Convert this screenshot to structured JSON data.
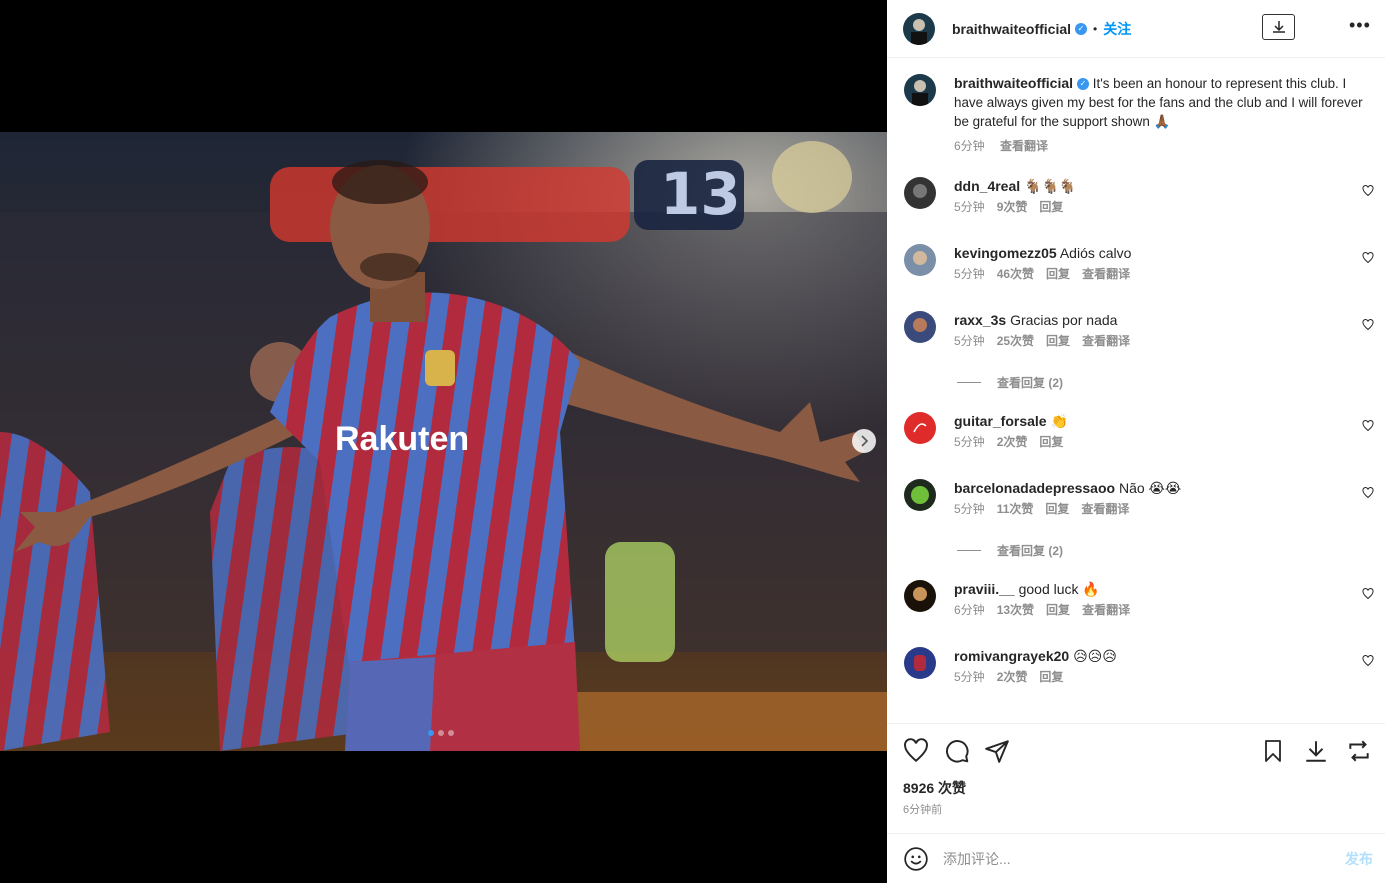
{
  "post": {
    "username": "braithwaiteofficial",
    "follow_label": "关注",
    "separator": "•",
    "more_label": "•••",
    "caption": "It's been an honour to represent this club. I have always given my best for the fans and the club and I will forever be grateful for the support shown 🙏🏾",
    "caption_time": "6分钟",
    "caption_translate": "查看翻译",
    "likes": "8926 次赞",
    "posted_ago": "6分钟前",
    "image_alt": "Footballer celebrating in red and blue striped Rakuten jersey",
    "carousel": {
      "count": 3,
      "active": 0
    }
  },
  "comments": [
    {
      "user": "ddn_4real",
      "text": "🐐🐐🐐",
      "time": "5分钟",
      "likes": "9次赞",
      "reply": "回复",
      "translate": ""
    },
    {
      "user": "kevingomezz05",
      "text": "Adiós calvo",
      "time": "5分钟",
      "likes": "46次赞",
      "reply": "回复",
      "translate": "查看翻译"
    },
    {
      "user": "raxx_3s",
      "text": "Gracias por nada",
      "time": "5分钟",
      "likes": "25次赞",
      "reply": "回复",
      "translate": "查看翻译",
      "view_replies": "查看回复 (2)"
    },
    {
      "user": "guitar_forsale",
      "text": "👏",
      "time": "5分钟",
      "likes": "2次赞",
      "reply": "回复",
      "translate": ""
    },
    {
      "user": "barcelonadadepressaoo",
      "text": "Não 😭😭",
      "time": "5分钟",
      "likes": "11次赞",
      "reply": "回复",
      "translate": "查看翻译",
      "view_replies": "查看回复 (2)"
    },
    {
      "user": "praviii.__",
      "text": "good luck 🔥",
      "time": "6分钟",
      "likes": "13次赞",
      "reply": "回复",
      "translate": "查看翻译"
    },
    {
      "user": "romivangrayek20",
      "text": "😥😥😥",
      "time": "5分钟",
      "likes": "2次赞",
      "reply": "回复",
      "translate": ""
    }
  ],
  "composer": {
    "placeholder": "添加评论...",
    "post_label": "发布"
  },
  "icons": {
    "like": "heart-icon",
    "comment": "comment-icon",
    "share": "paper-plane-icon",
    "save": "bookmark-icon",
    "download": "download-icon",
    "repost": "repost-icon",
    "emoji": "emoji-icon"
  },
  "colors": {
    "follow": "#0095f6",
    "verified": "#3897f0",
    "muted": "#8e8e8e",
    "post_disabled": "#b2dffc"
  }
}
